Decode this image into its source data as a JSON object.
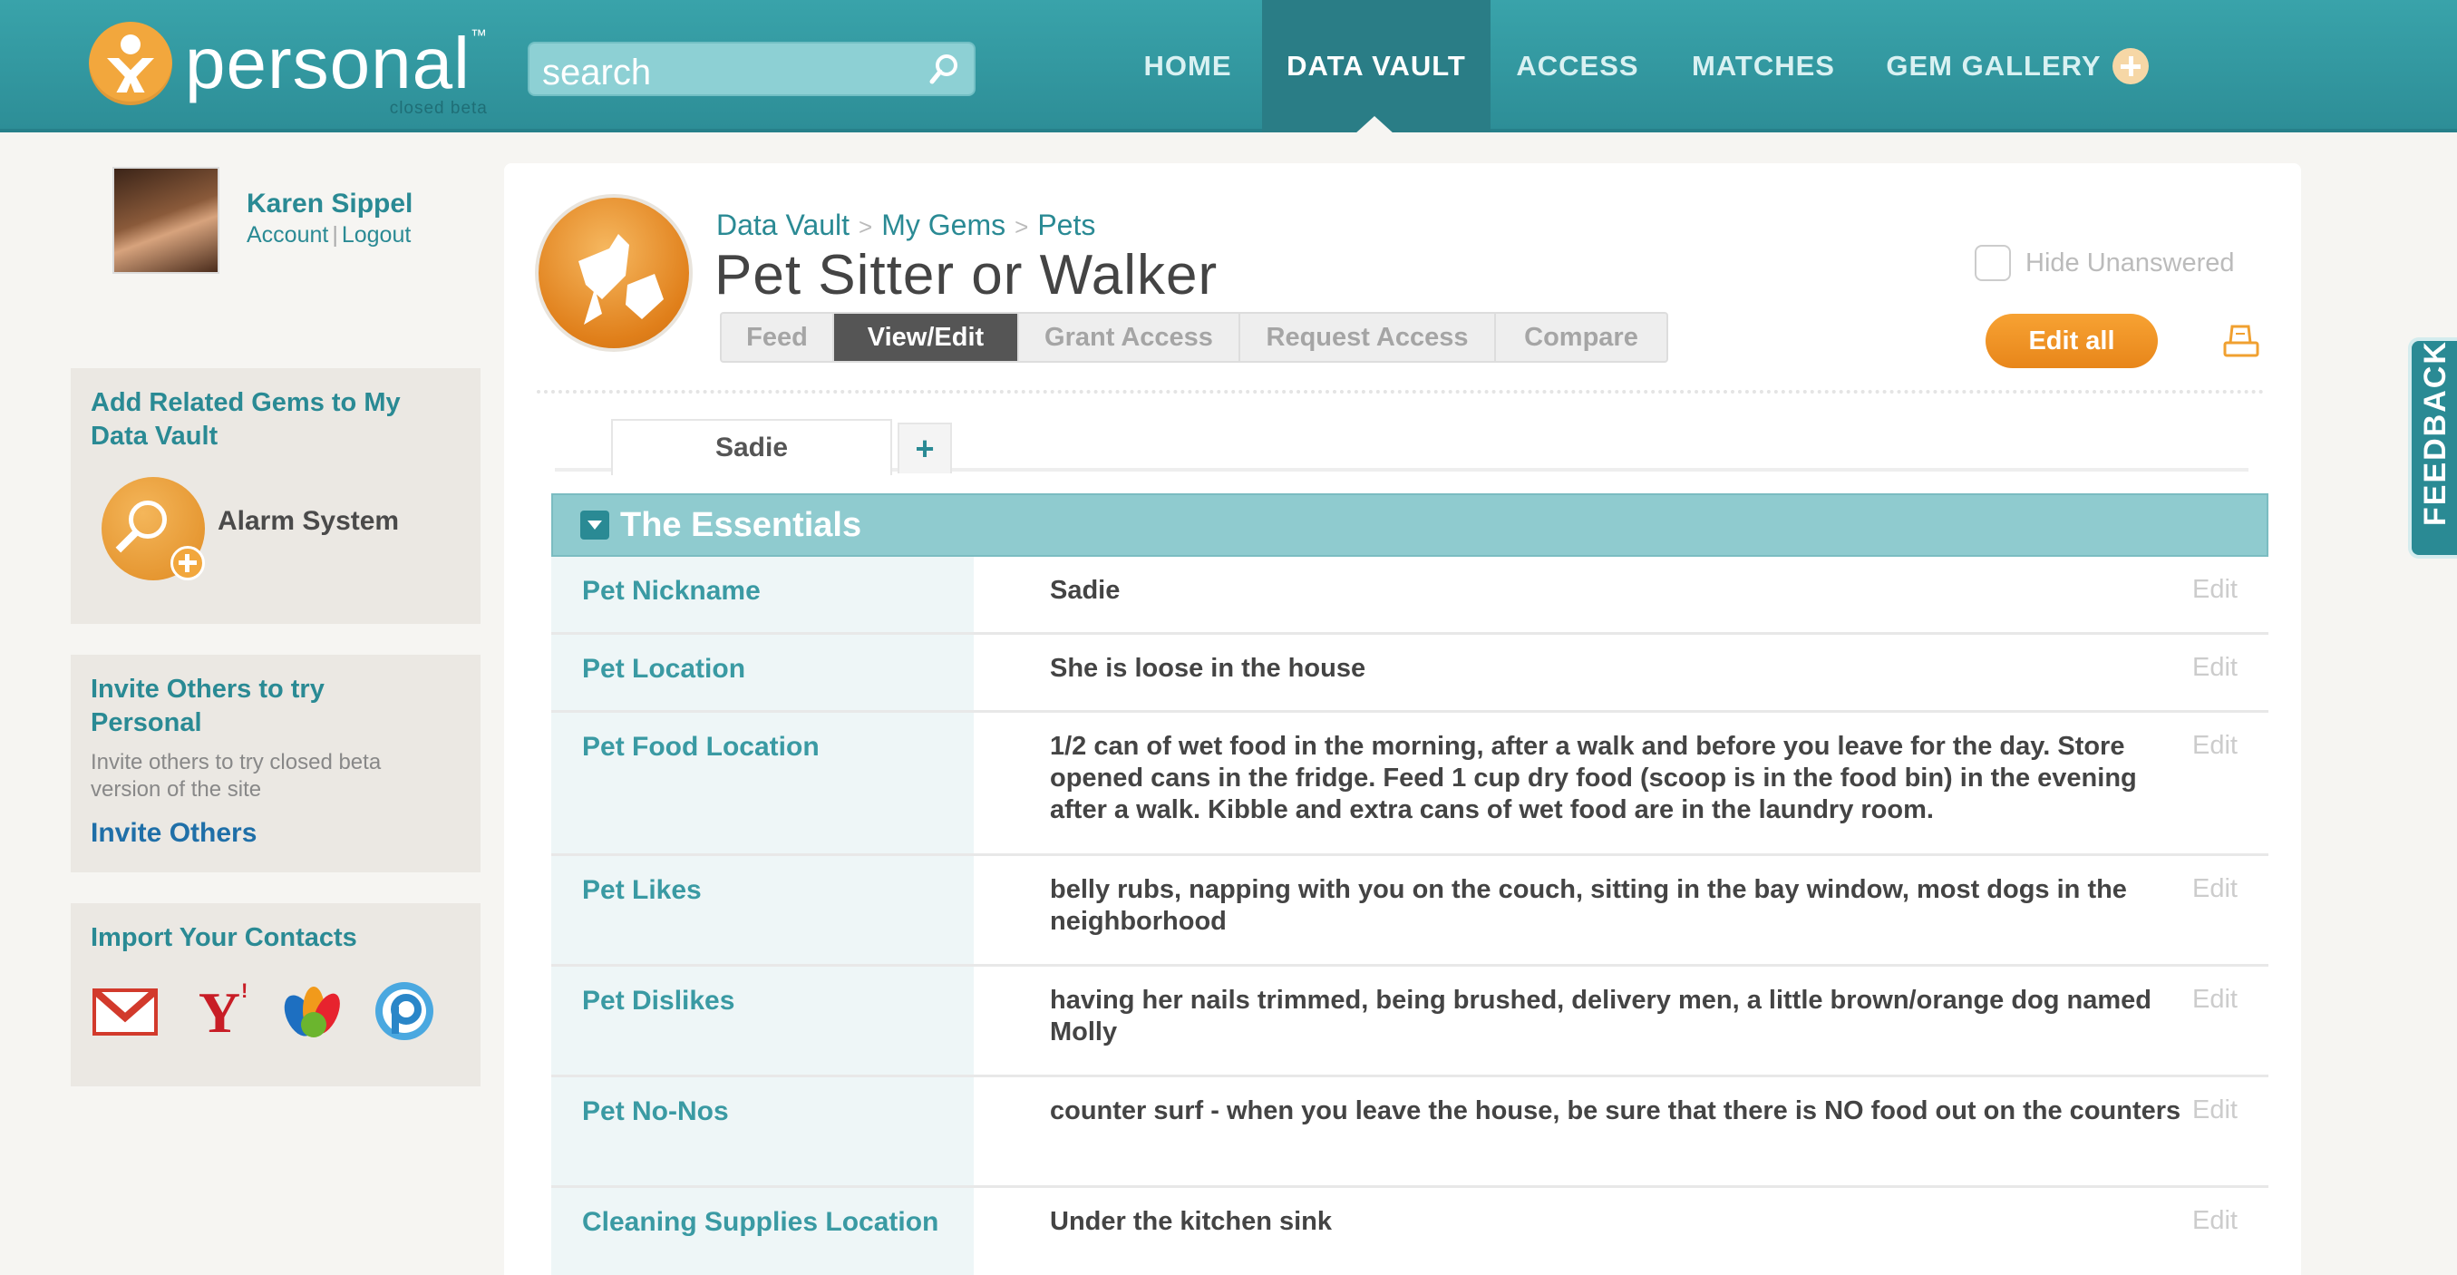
{
  "header": {
    "logo_text": "personal",
    "logo_tm": "™",
    "logo_sub": "closed beta",
    "search_placeholder": "search",
    "nav": [
      {
        "label": "HOME"
      },
      {
        "label": "DATA VAULT"
      },
      {
        "label": "ACCESS"
      },
      {
        "label": "MATCHES"
      },
      {
        "label": "GEM GALLERY"
      }
    ],
    "active_nav": "DATA VAULT"
  },
  "user": {
    "name": "Karen Sippel",
    "account_label": "Account",
    "separator": "|",
    "logout_label": "Logout"
  },
  "sidebar": {
    "related": {
      "title": "Add Related Gems to My Data Vault",
      "gem_label": "Alarm System"
    },
    "invite": {
      "title": "Invite Others to try Personal",
      "description": "Invite others to try closed beta version of the site",
      "link": "Invite Others"
    },
    "import": {
      "title": "Import Your Contacts",
      "icons": [
        "gmail-icon",
        "yahoo-icon",
        "msn-icon",
        "plaxo-icon"
      ]
    }
  },
  "main": {
    "breadcrumb": [
      "Data Vault",
      "My Gems",
      "Pets"
    ],
    "breadcrumb_sep": ">",
    "title": "Pet Sitter or Walker",
    "tabs": [
      {
        "label": "Feed"
      },
      {
        "label": "View/Edit"
      },
      {
        "label": "Grant Access"
      },
      {
        "label": "Request Access"
      },
      {
        "label": "Compare"
      }
    ],
    "active_tab": "View/Edit",
    "hide_unanswered_label": "Hide Unanswered",
    "hide_unanswered_checked": false,
    "edit_all_label": "Edit all",
    "pet_tab_label": "Sadie",
    "add_tab_label": "+",
    "section_title": "The Essentials",
    "edit_label": "Edit",
    "rows": [
      {
        "label": "Pet Nickname",
        "value": "Sadie"
      },
      {
        "label": "Pet Location",
        "value": "She is loose in the house"
      },
      {
        "label": "Pet Food Location",
        "value": "1/2 can of wet food in the morning, after a walk and before you leave for the day. Store opened cans in the fridge. Feed 1 cup dry food (scoop is in the food bin) in the evening after a walk. Kibble and extra cans of wet food are in the laundry room."
      },
      {
        "label": "Pet Likes",
        "value": "belly rubs, napping with you on the couch, sitting in the bay window, most dogs in the neighborhood"
      },
      {
        "label": "Pet Dislikes",
        "value": "having her nails trimmed, being brushed, delivery men, a little brown/orange dog named Molly"
      },
      {
        "label": "Pet No-Nos",
        "value": "counter surf - when you leave the house, be sure that there is NO food out on the counters"
      },
      {
        "label": "Cleaning Supplies Location",
        "value": "Under the kitchen sink"
      }
    ]
  },
  "feedback_label": "FEEDBACK",
  "colors": {
    "header_teal": "#39a3aa",
    "accent_orange": "#f2a73d",
    "label_teal": "#3a9aa3",
    "link_blue": "#1f6fa8"
  }
}
